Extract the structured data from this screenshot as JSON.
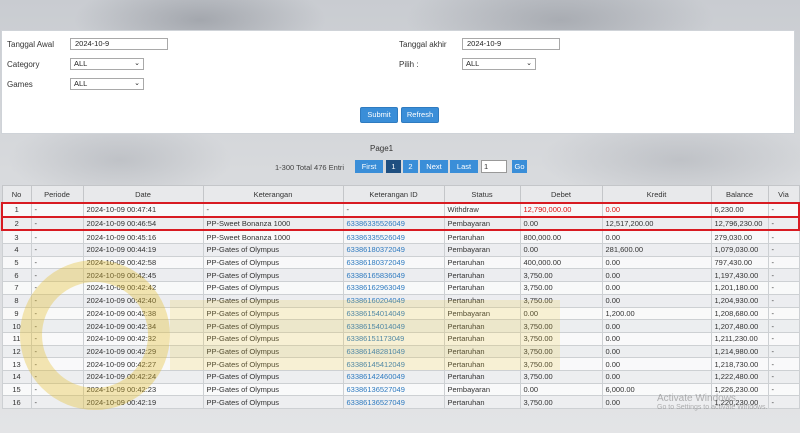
{
  "filters": {
    "start_label": "Tanggal Awal",
    "start_value": "2024-10-9",
    "end_label": "Tanggal akhir",
    "end_value": "2024-10-9",
    "category_label": "Category",
    "category_value": "ALL",
    "pilih_label": "Pilih :",
    "pilih_value": "ALL",
    "games_label": "Games",
    "games_value": "ALL",
    "submit_label": "Submit",
    "refresh_label": "Refresh"
  },
  "pager": {
    "title": "Page1",
    "info": "1-300 Total 476 Entri",
    "first": "First",
    "p1": "1",
    "p2": "2",
    "next": "Next",
    "last": "Last",
    "input": "1",
    "go": "Go"
  },
  "table": {
    "headers": [
      "No",
      "Periode",
      "Date",
      "Keterangan",
      "Keterangan ID",
      "Status",
      "Debet",
      "Kredit",
      "Balance",
      "Via"
    ],
    "rows": [
      [
        "1",
        "-",
        "2024-10-09 00:47:41",
        "-",
        "-",
        "Withdraw",
        "12,790,000.00",
        "0.00",
        "6,230.00",
        "-"
      ],
      [
        "2",
        "-",
        "2024-10-09 00:46:54",
        "PP-Sweet Bonanza 1000",
        "63386335526049",
        "Pembayaran",
        "0.00",
        "12,517,200.00",
        "12,796,230.00",
        "-"
      ],
      [
        "3",
        "-",
        "2024-10-09 00:45:16",
        "PP-Sweet Bonanza 1000",
        "63386335526049",
        "Pertaruhan",
        "800,000.00",
        "0.00",
        "279,030.00",
        "-"
      ],
      [
        "4",
        "-",
        "2024-10-09 00:44:19",
        "PP-Gates of Olympus",
        "63386180372049",
        "Pembayaran",
        "0.00",
        "281,600.00",
        "1,079,030.00",
        "-"
      ],
      [
        "5",
        "-",
        "2024-10-09 00:42:58",
        "PP-Gates of Olympus",
        "63386180372049",
        "Pertaruhan",
        "400,000.00",
        "0.00",
        "797,430.00",
        "-"
      ],
      [
        "6",
        "-",
        "2024-10-09 00:42:45",
        "PP-Gates of Olympus",
        "63386165836049",
        "Pertaruhan",
        "3,750.00",
        "0.00",
        "1,197,430.00",
        "-"
      ],
      [
        "7",
        "-",
        "2024-10-09 00:42:42",
        "PP-Gates of Olympus",
        "63386162963049",
        "Pertaruhan",
        "3,750.00",
        "0.00",
        "1,201,180.00",
        "-"
      ],
      [
        "8",
        "-",
        "2024-10-09 00:42:40",
        "PP-Gates of Olympus",
        "63386160204049",
        "Pertaruhan",
        "3,750.00",
        "0.00",
        "1,204,930.00",
        "-"
      ],
      [
        "9",
        "-",
        "2024-10-09 00:42:38",
        "PP-Gates of Olympus",
        "63386154014049",
        "Pembayaran",
        "0.00",
        "1,200.00",
        "1,208,680.00",
        "-"
      ],
      [
        "10",
        "-",
        "2024-10-09 00:42:34",
        "PP-Gates of Olympus",
        "63386154014049",
        "Pertaruhan",
        "3,750.00",
        "0.00",
        "1,207,480.00",
        "-"
      ],
      [
        "11",
        "-",
        "2024-10-09 00:42:32",
        "PP-Gates of Olympus",
        "63386151173049",
        "Pertaruhan",
        "3,750.00",
        "0.00",
        "1,211,230.00",
        "-"
      ],
      [
        "12",
        "-",
        "2024-10-09 00:42:29",
        "PP-Gates of Olympus",
        "63386148281049",
        "Pertaruhan",
        "3,750.00",
        "0.00",
        "1,214,980.00",
        "-"
      ],
      [
        "13",
        "-",
        "2024-10-09 00:42:27",
        "PP-Gates of Olympus",
        "63386145412049",
        "Pertaruhan",
        "3,750.00",
        "0.00",
        "1,218,730.00",
        "-"
      ],
      [
        "14",
        "-",
        "2024-10-09 00:42:24",
        "PP-Gates of Olympus",
        "63386142460049",
        "Pertaruhan",
        "3,750.00",
        "0.00",
        "1,222,480.00",
        "-"
      ],
      [
        "15",
        "-",
        "2024-10-09 00:42:23",
        "PP-Gates of Olympus",
        "63386136527049",
        "Pembayaran",
        "0.00",
        "6,000.00",
        "1,226,230.00",
        "-"
      ],
      [
        "16",
        "-",
        "2024-10-09 00:42:19",
        "PP-Gates of Olympus",
        "63386136527049",
        "Pertaruhan",
        "3,750.00",
        "0.00",
        "1,220,230.00",
        "-"
      ]
    ]
  },
  "activate": {
    "line1": "Activate Windows",
    "line2": "Go to Settings to activate Windows."
  },
  "colors": {
    "accent": "#3a8ed8",
    "highlight": "#d81b22",
    "link": "#2f7bc0"
  }
}
